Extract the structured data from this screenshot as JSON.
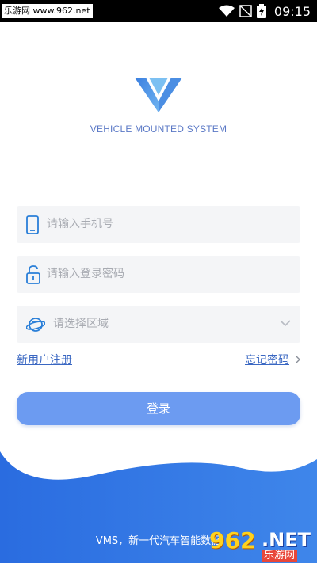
{
  "status_bar": {
    "site": "乐游网 www.962.net",
    "time": "09:15"
  },
  "logo": {
    "subtitle": "VEHICLE MOUNTED SYSTEM"
  },
  "form": {
    "phone_placeholder": "请输入手机号",
    "password_placeholder": "请输入登录密码",
    "region_placeholder": "请选择区域"
  },
  "links": {
    "register": "新用户注册",
    "forgot_password": "忘记密码"
  },
  "login_button": "登录",
  "footer": "VMS，新一代汽车智能数据",
  "watermark": {
    "number": "962",
    "suffix": ".NET",
    "brand": "乐游网"
  },
  "colors": {
    "accent": "#6c9bf1",
    "wave_blue": "#2f6fdf",
    "link": "#3a67c2",
    "logo_blue": "#4a8fe0"
  }
}
